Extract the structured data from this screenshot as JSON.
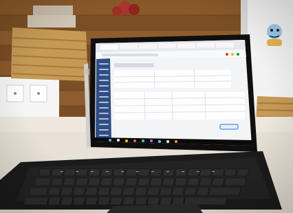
{
  "scene": {
    "subject": "laptop-on-table",
    "screen_ui": {
      "browser_tabs_count": 7,
      "sidebar_items_count": 14,
      "has_search_bar": true,
      "has_taskbar": true
    },
    "keyboard": {
      "rows": 5
    },
    "colors": {
      "wall_wood": "#8a5a2b",
      "wall_wood_light": "#b07a43",
      "table": "#e7e1d7",
      "laptop_bezel": "#111111",
      "screen_bg": "#f3f4f6",
      "sidebar": "#2f4e86",
      "accent": "#1e6fe0",
      "keyboard": "#222222",
      "basket": "#c59a55"
    }
  }
}
